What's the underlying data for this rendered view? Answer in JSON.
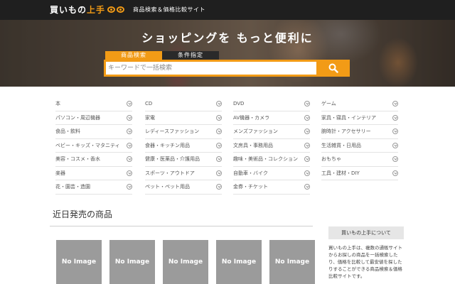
{
  "header": {
    "logo_main": "買いもの",
    "logo_accent": "上手",
    "tagline": "商品検索＆価格比較サイト"
  },
  "hero": {
    "headline": "ショッピングを もっと便利に",
    "tabs": [
      {
        "label": "商品検索",
        "active": true
      },
      {
        "label": "条件指定",
        "active": false
      }
    ],
    "search_placeholder": "キーワードで一括検索",
    "search_icon": "search-icon"
  },
  "categories": {
    "columns": [
      [
        "本",
        "パソコン・周辺機器",
        "食品・飲料",
        "ベビー・キッズ・マタニティ",
        "美容・コスメ・香水",
        "楽器",
        "花・園芸・造園"
      ],
      [
        "CD",
        "家電",
        "レディースファッション",
        "食器・キッチン用品",
        "健康・医薬品・介護用品",
        "スポーツ・アウトドア",
        "ペット・ペット用品"
      ],
      [
        "DVD",
        "AV機器・カメラ",
        "メンズファッション",
        "文房具・事務用品",
        "趣味・美術品・コレクション",
        "自動車・バイク",
        "金券・チケット"
      ],
      [
        "ゲーム",
        "家具・寝具・インテリア",
        "腕時計・アクセサリー",
        "生活雑貨・日用品",
        "おもちゃ",
        "工具・建材・DIY"
      ]
    ]
  },
  "upcoming": {
    "title": "近日発売の商品",
    "items": [
      "No Image",
      "No Image",
      "No Image",
      "No Image",
      "No Image"
    ]
  },
  "about": {
    "title": "買いもの上手について",
    "body": "買いもの上手は、複数の通販サイトからお探しの商品を一括検索したり、価格を比較して最安値を探したりすることができる商品検索＆価格比較サイトです。"
  },
  "colors": {
    "accent": "#f29b16",
    "topbar": "#1f1f1f",
    "noimage": "#9b9b9b"
  }
}
